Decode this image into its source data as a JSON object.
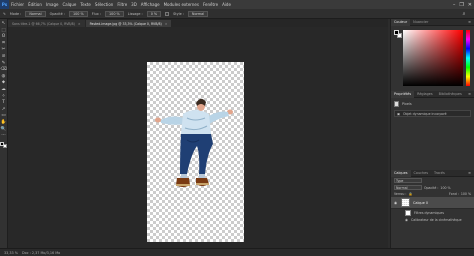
{
  "app": {
    "logo": "Ps"
  },
  "menu": [
    "Fichier",
    "Édition",
    "Image",
    "Calque",
    "Texte",
    "Sélection",
    "Filtre",
    "3D",
    "Affichage",
    "Modules externes",
    "Fenêtre",
    "Aide"
  ],
  "window_controls": [
    "–",
    "❐",
    "✕"
  ],
  "options": {
    "mode_label": "Mode :",
    "mode_value": "Normal",
    "opacity_label": "Opacité :",
    "opacity_value": "100 %",
    "flow_label": "Flux :",
    "flow_value": "100 %",
    "smoothing_label": "Lissage :",
    "smoothing_value": "0 %",
    "style_label": "Style :",
    "style_value": "Normal",
    "search_icon": "search-icon"
  },
  "tabs": [
    {
      "label": "Sans titre-1 @ 66,7% (Calque 0, RVB/8)",
      "active": false
    },
    {
      "label": "Pasted-image.jpg @ 33,3% (Calque 0, RVB/8)",
      "active": true
    }
  ],
  "tools": [
    "↖",
    "⬚",
    "ʘ",
    "⌗",
    "✂",
    "⊘",
    "✎",
    "⌫",
    "◍",
    "⬥",
    "☁",
    "✧",
    "T",
    "↗",
    "▭",
    "✋",
    "🔍",
    "⋯"
  ],
  "status": {
    "zoom": "33,33 %",
    "doc_size": "Doc : 2,37 Mo/3,16 Mo"
  },
  "color_panel": {
    "tabs": [
      "Couleur",
      "Nuancier"
    ],
    "fg": "#000000",
    "bg": "#ffffff",
    "hue": "#ff0000"
  },
  "properties_panel": {
    "tabs": [
      "Propriétés",
      "Réglages",
      "Bibliothèques"
    ],
    "type_label": "Pixels",
    "object_label": "Objet dynamique incorporé"
  },
  "layers_panel": {
    "tabs": [
      "Calques",
      "Couches",
      "Tracés"
    ],
    "filter_label": "Type",
    "blend_value": "Normal",
    "opacity_label": "Opacité :",
    "opacity_value": "100 %",
    "lock_label": "Verrou :",
    "fill_label": "Fond :",
    "fill_value": "100 %",
    "layer_name": "Calque 0",
    "sub1": "Filtres dynamiques",
    "sub2": "Calibrateur de la cinémathèque"
  }
}
